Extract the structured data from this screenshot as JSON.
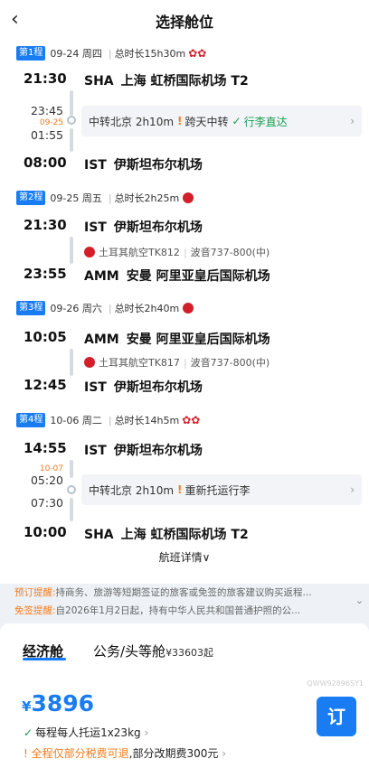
{
  "header": {
    "back_icon": "‹",
    "title": "选择舱位"
  },
  "segments": [
    {
      "badge": "第1程",
      "date": "09-24 周四",
      "duration": "总时长15h30m",
      "airline_icon": "air-china-logo",
      "dep_time": "21:30",
      "dep_code": "SHA",
      "dep_airport": "上海 虹桥国际机场 T2",
      "transfer": {
        "arr_time": "23:45",
        "dplus": "09-25",
        "dep_time": "01:55",
        "city": "中转北京 2h10m",
        "warn": "跨天中转",
        "ok": "行李直达"
      },
      "arr_time": "08:00",
      "arr_code": "IST",
      "arr_airport": "伊斯坦布尔机场"
    },
    {
      "badge": "第2程",
      "date": "09-25 周五",
      "duration": "总时长2h25m",
      "airline_icon": "turkish-airlines-logo",
      "dep_time": "21:30",
      "dep_code": "IST",
      "dep_airport": "伊斯坦布尔机场",
      "flight": {
        "airline": "土耳其航空TK812",
        "aircraft": "波音737-800(中)"
      },
      "arr_time": "23:55",
      "arr_code": "AMM",
      "arr_airport": "安曼 阿里亚皇后国际机场"
    },
    {
      "badge": "第3程",
      "date": "09-26 周六",
      "duration": "总时长2h40m",
      "airline_icon": "turkish-airlines-logo",
      "dep_time": "10:05",
      "dep_code": "AMM",
      "dep_airport": "安曼 阿里亚皇后国际机场",
      "flight": {
        "airline": "土耳其航空TK817",
        "aircraft": "波音737-800(中)"
      },
      "arr_time": "12:45",
      "arr_code": "IST",
      "arr_airport": "伊斯坦布尔机场"
    },
    {
      "badge": "第4程",
      "date": "10-06 周二",
      "duration": "总时长14h5m",
      "airline_icon": "air-china-logo",
      "dep_time": "14:55",
      "dep_code": "IST",
      "dep_airport": "伊斯坦布尔机场",
      "transfer": {
        "dplus": "10-07",
        "arr_time": "05:20",
        "dep_time": "07:30",
        "city": "中转北京 2h10m",
        "warn": "重新托运行李"
      },
      "arr_time": "10:00",
      "arr_code": "SHA",
      "arr_airport": "上海 虹桥国际机场 T2"
    }
  ],
  "details_link": "航班详情∨",
  "notices": [
    {
      "tag": "预订提醒:",
      "text": "持商务、旅游等短期签证的旅客或免签的旅客建议购买返程..."
    },
    {
      "tag": "免签提醒:",
      "text": "自2026年1月2日起，持有中华人民共和国普通护照的公..."
    }
  ],
  "cabin_tabs": [
    {
      "label": "经济舱",
      "price": ""
    },
    {
      "label": "公务/头等舱",
      "price": "¥33603起"
    }
  ],
  "offer": {
    "currency": "¥",
    "price": "3896",
    "watermark": "QWW92896SY1",
    "book_label": "订",
    "bag_text": "每程每人托运1x23kg",
    "refund_highlight": "全程仅部分税费可退",
    "refund_rest": ",部分改期费300元"
  },
  "colors": {
    "accent": "#1a7cf3",
    "warn": "#f37b1d",
    "ok": "#1a9e52",
    "air_red": "#d21f2a"
  }
}
